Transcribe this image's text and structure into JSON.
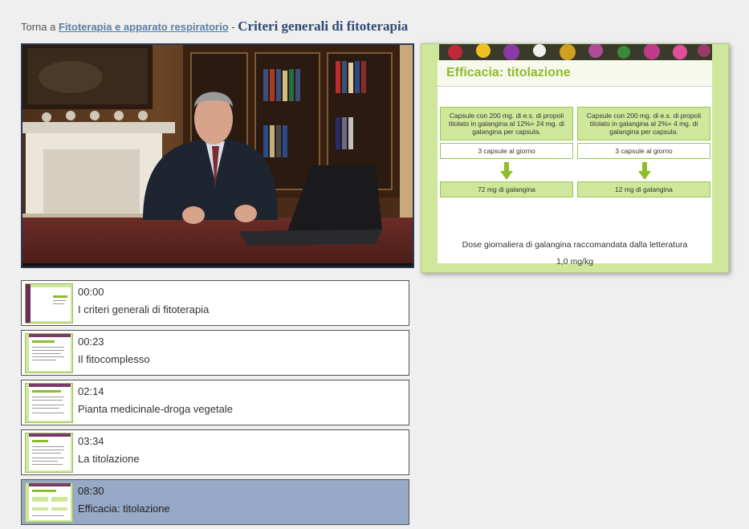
{
  "breadcrumb": {
    "prefix": "Torna a",
    "link": "Fitoterapia e apparato respiratorio",
    "separator": "-",
    "title": "Criteri generali di fitoterapia"
  },
  "slide": {
    "title": "Efficacia: titolazione",
    "left_box": "Capsule con 200 mg. di e.s. di propoli titolato in galangina al 12%= 24 mg. di galangina per capsula.",
    "right_box": "Capsule con 200 mg. di e.s. di propoli titolato in galangina al 2%= 4 mg. di galangina per capsula.",
    "left_dose": "3 capsule al giorno",
    "right_dose": "3 capsule al giorno",
    "left_result": "72 mg di galangina",
    "right_result": "12 mg di galangina",
    "footer_line1": "Dose giornaliera di galangina raccomandata dalla letteratura",
    "footer_line2": "1,0 mg/kg"
  },
  "chapters": [
    {
      "time": "00:00",
      "label": "I criteri generali di fitoterapia"
    },
    {
      "time": "00:23",
      "label": "Il fitocomplesso"
    },
    {
      "time": "02:14",
      "label": "Pianta medicinale-droga vegetale"
    },
    {
      "time": "03:34",
      "label": "La titolazione"
    },
    {
      "time": "08:30",
      "label": "Efficacia: titolazione",
      "active": true
    }
  ],
  "colors": {
    "accent_green": "#8dbd2a",
    "active_row": "#96a9c6",
    "title_blue": "#2e4a74",
    "link_blue": "#5b7fa8"
  }
}
